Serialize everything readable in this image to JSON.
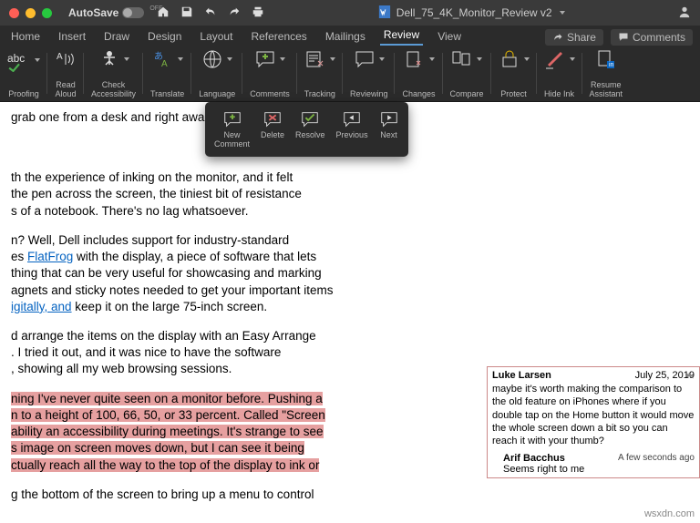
{
  "titlebar": {
    "autosave_label": "AutoSave",
    "autosave_off": "OFF",
    "docname": "Dell_75_4K_Monitor_Review v2"
  },
  "tabs": {
    "items": [
      "Home",
      "Insert",
      "Draw",
      "Design",
      "Layout",
      "References",
      "Mailings",
      "Review",
      "View"
    ],
    "active": "Review",
    "share": "Share",
    "comments": "Comments"
  },
  "ribbon": {
    "proofing": "Proofing",
    "readaloud": "Read\nAloud",
    "checkacc": "Check\nAccessibility",
    "translate": "Translate",
    "language": "Language",
    "comments": "Comments",
    "tracking": "Tracking",
    "reviewing": "Reviewing",
    "changes": "Changes",
    "compare": "Compare",
    "protect": "Protect",
    "hideink": "Hide Ink",
    "resume": "Resume\nAssistant"
  },
  "flyout": {
    "newcomment": "New\nComment",
    "delete": "Delete",
    "resolve": "Resolve",
    "previous": "Previous",
    "next": "Next"
  },
  "doc": {
    "p1": "grab one from a desk and right awa",
    "p2a": "th the experience of inking on the monitor, and it felt",
    "p2b": "the pen across the screen, the tiniest bit of resistance",
    "p2c": "s of a notebook. There's no lag whatsoever.",
    "p3a": "n? Well, Dell includes support for industry-standard",
    "p3b_pre": "es ",
    "p3b_link": "FlatFrog",
    "p3b_post": " with the display, a piece of software that lets",
    "p3c": "thing that can be very useful for showcasing and marking",
    "p3d": "agnets and sticky notes needed to get your important items",
    "p3e_pre": "",
    "p3e_link": "igitally, and",
    "p3e_post": " keep it on the large 75-inch screen.",
    "p4a": "d arrange the items on the display with an Easy Arrange",
    "p4b": ". I tried it out, and it was nice to have the software",
    "p4c": ", showing all my web browsing sessions.",
    "p5a": "ning I've never quite seen on a monitor before. Pushing a",
    "p5b": "n to a height of 100, 66, 50, or 33 percent. Called \"Screen",
    "p5c": "ability an accessibility during meetings. It's strange to see",
    "p5d": "s image on screen moves down, but I can see it being",
    "p5e": "ctually reach all the way to the top of the display to ink or",
    "p6": "g the bottom of the screen to bring up a menu to control"
  },
  "comments": {
    "c1_author": "Luke Larsen",
    "c1_date": "July 25, 2019",
    "c1_body": "maybe it's worth making the comparison to the old feature on iPhones where if you double tap on the Home button it would move the whole screen down a bit so you can reach it with your thumb?",
    "c2_author": "Arif Bacchus",
    "c2_time": "A few seconds ago",
    "c2_body": "Seems right to me"
  },
  "watermark": "wsxdn.com"
}
